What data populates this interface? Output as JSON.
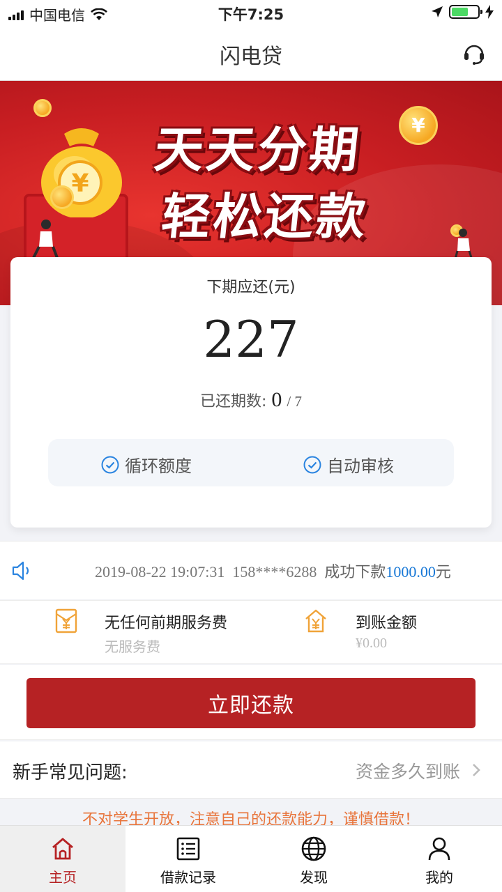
{
  "status_bar": {
    "carrier": "中国电信",
    "time": "下午7:25"
  },
  "header": {
    "title": "闪电贷"
  },
  "banner": {
    "line1": "天天分期",
    "line2": "轻松还款",
    "coin_symbol": "¥"
  },
  "repay_card": {
    "label": "下期应还(元)",
    "amount": "227",
    "paid_label": "已还期数:",
    "paid_count": "0",
    "total_periods": "/ 7",
    "features": [
      "循环额度",
      "自动审核"
    ]
  },
  "ticker": {
    "datetime": "2019-08-22 19:07:31",
    "phone": "158****6288",
    "action": "成功下款",
    "amount": "1000.00",
    "unit": "元"
  },
  "info": {
    "fee_title": "无任何前期服务费",
    "fee_sub": "无服务费",
    "arrival_title": "到账金额",
    "arrival_sub": "¥0.00"
  },
  "repay_button": "立即还款",
  "faq": {
    "label": "新手常见问题:",
    "question": "资金多久到账"
  },
  "notice": "不对学生开放，注意自己的还款能力，谨慎借款！",
  "tabs": [
    {
      "label": "主页",
      "icon": "home-icon",
      "active": true
    },
    {
      "label": "借款记录",
      "icon": "list-icon",
      "active": false
    },
    {
      "label": "发现",
      "icon": "globe-icon",
      "active": false
    },
    {
      "label": "我的",
      "icon": "person-icon",
      "active": false
    }
  ],
  "colors": {
    "brand_red": "#b62224",
    "link_blue": "#1677d6",
    "notice_orange": "#e8743b",
    "check_blue": "#2a84e0",
    "icon_orange": "#f0a338"
  }
}
